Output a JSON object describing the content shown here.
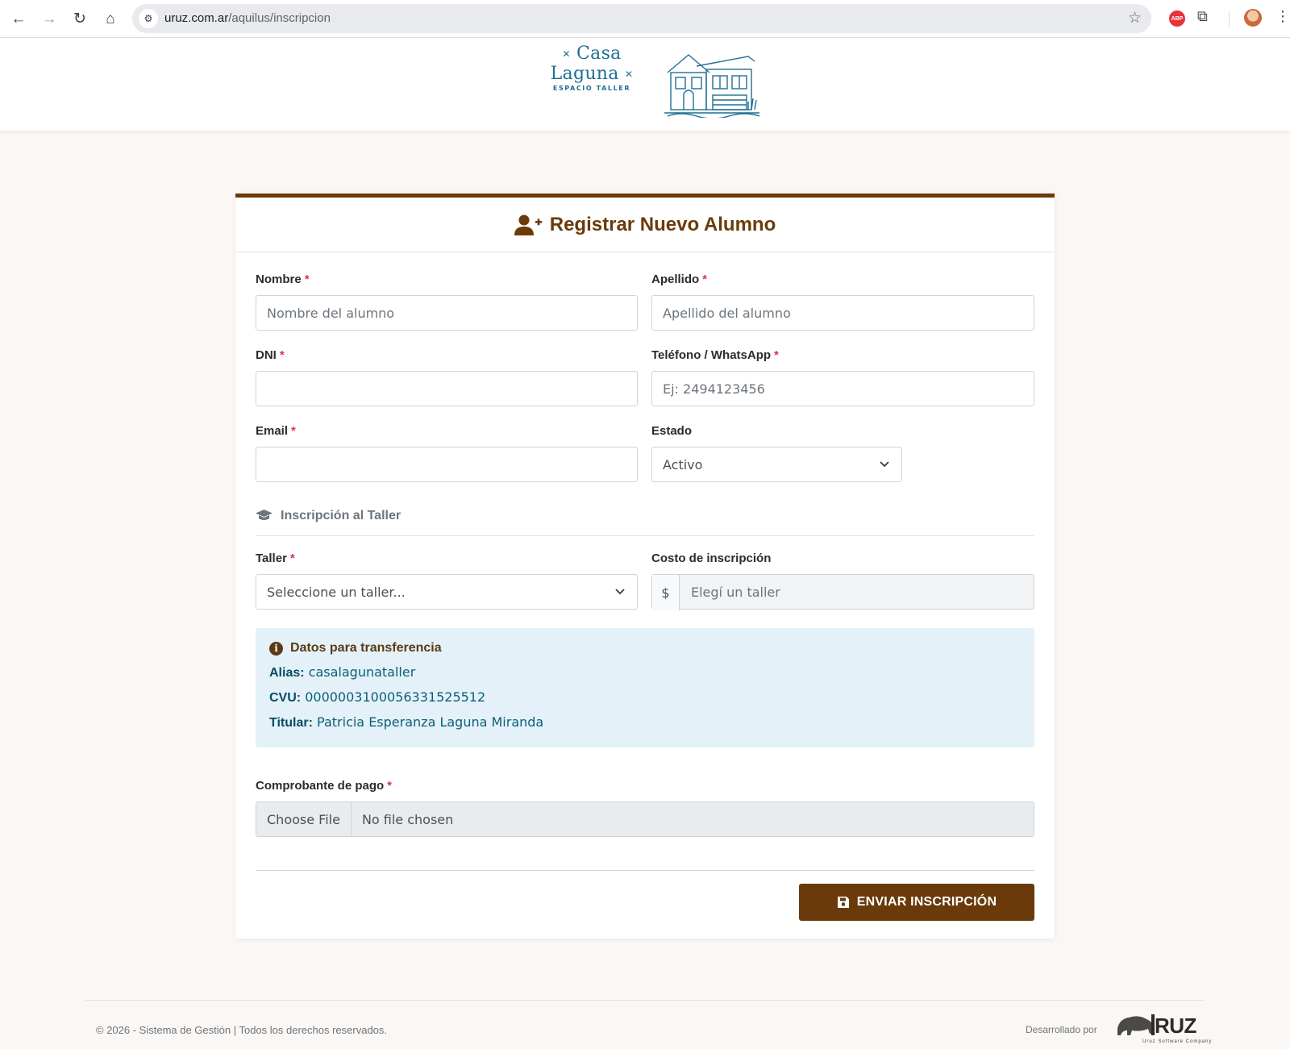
{
  "browser": {
    "url_host": "uruz.com.ar",
    "url_path": "/aquilus/inscripcion",
    "adblock_badge": "ABP"
  },
  "brand": {
    "name": "Casa Laguna",
    "subtitle": "ESPACIO TALLER",
    "accent_color": "#6b3a0b",
    "logo_color": "#1f6f94"
  },
  "form": {
    "title": "Registrar Nuevo Alumno",
    "required_mark": "*",
    "nombre": {
      "label": "Nombre",
      "placeholder": "Nombre del alumno"
    },
    "apellido": {
      "label": "Apellido",
      "placeholder": "Apellido del alumno"
    },
    "dni": {
      "label": "DNI",
      "placeholder": ""
    },
    "telefono": {
      "label": "Teléfono / WhatsApp",
      "placeholder": "Ej: 2494123456"
    },
    "email": {
      "label": "Email",
      "placeholder": ""
    },
    "estado": {
      "label": "Estado",
      "value": "Activo"
    },
    "section_title": "Inscripción al Taller",
    "taller": {
      "label": "Taller",
      "value": "Seleccione un taller..."
    },
    "costo": {
      "label": "Costo de inscripción",
      "currency": "$",
      "placeholder": "Elegí un taller"
    },
    "transfer": {
      "title": "Datos para transferencia",
      "alias_key": "Alias:",
      "alias_value": "casalagunataller",
      "cvu_key": "CVU:",
      "cvu_value": "0000003100056331525512",
      "titular_key": "Titular:",
      "titular_value": "Patricia Esperanza Laguna Miranda"
    },
    "comprobante": {
      "label": "Comprobante de pago",
      "button": "Choose File",
      "status": "No file chosen"
    },
    "submit_label": "ENVIAR INSCRIPCIÓN"
  },
  "footer": {
    "copyright": "© 2026 - Sistema de Gestión | Todos los derechos reservados.",
    "developed_by": "Desarrollado por",
    "dev_logo_text": "RUZ",
    "dev_logo_sub": "Uruz Software Company"
  }
}
